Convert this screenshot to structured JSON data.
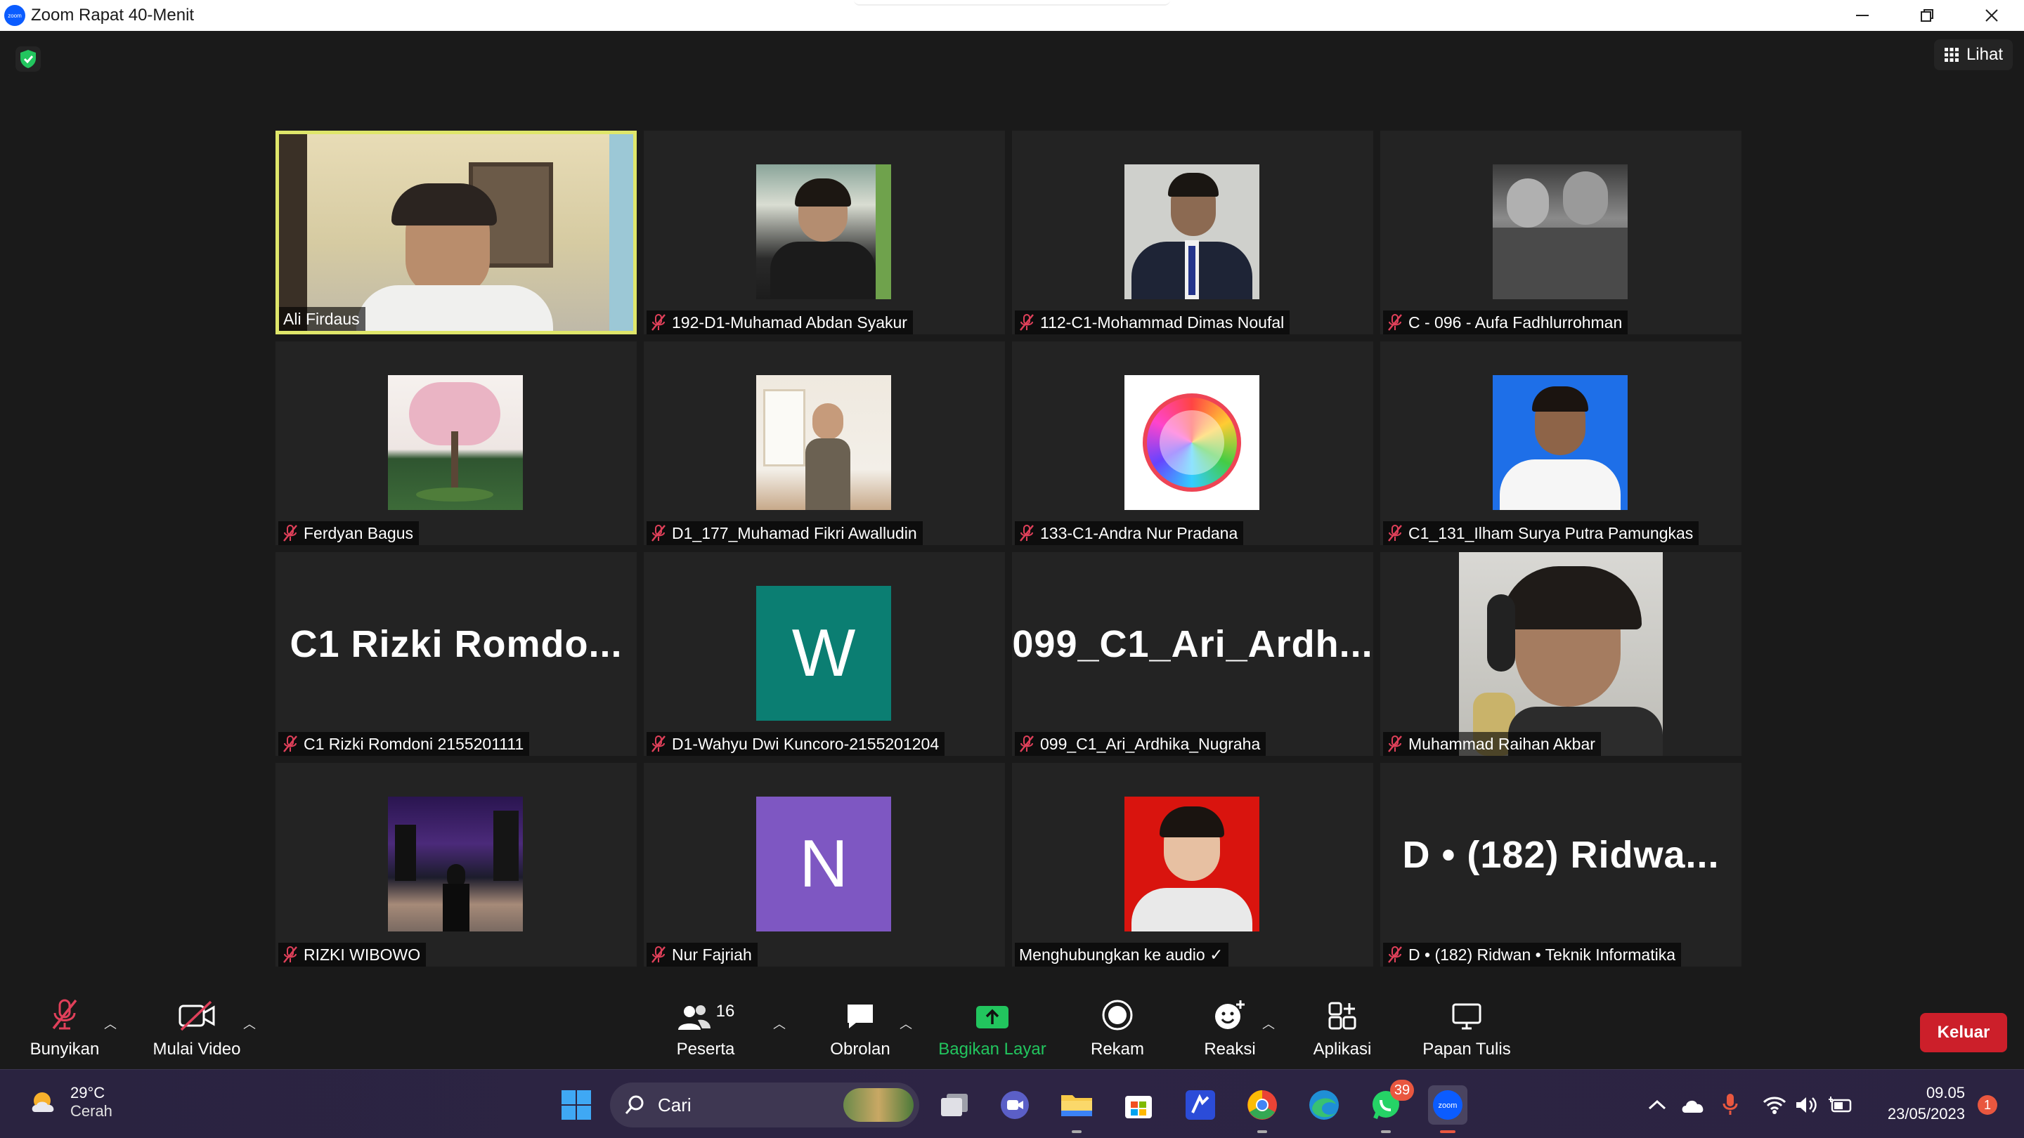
{
  "window": {
    "title": "Zoom Rapat 40-Menit",
    "logo_text": "zoom"
  },
  "view_button": {
    "label": "Lihat"
  },
  "participants": [
    {
      "name": "Ali Firdaus",
      "muted": false,
      "active": true,
      "avatar": "video-man-room"
    },
    {
      "name": "192-D1-Muhamad Abdan Syakur",
      "muted": true,
      "avatar": "photo-man-black-shirt"
    },
    {
      "name": "112-C1-Mohammad Dimas Noufal",
      "muted": true,
      "avatar": "photo-man-suit"
    },
    {
      "name": "C - 096 - Aufa Fadhlurrohman",
      "muted": true,
      "avatar": "photo-bw-men"
    },
    {
      "name": "Ferdyan Bagus",
      "muted": true,
      "avatar": "photo-pink-tree"
    },
    {
      "name": "D1_177_Muhamad Fikri Awalludin",
      "muted": true,
      "avatar": "photo-man-train"
    },
    {
      "name": "133-C1-Andra Nur Pradana",
      "muted": true,
      "avatar": "photo-rainbow-logo"
    },
    {
      "name": "C1_131_Ilham Surya Putra Pamungkas",
      "muted": true,
      "avatar": "photo-man-blue-bg"
    },
    {
      "name": "C1 Rizki Romdoni 2155201111",
      "muted": true,
      "big_name": "C1 Rizki Romdo..."
    },
    {
      "name": "D1-Wahyu Dwi Kuncoro-2155201204",
      "muted": true,
      "letter": "W",
      "letter_color": "#0b7e72"
    },
    {
      "name": "099_C1_Ari_Ardhika_Nugraha",
      "muted": true,
      "big_name": "099_C1_Ari_Ardh..."
    },
    {
      "name": "Muhammad Raihan Akbar",
      "muted": true,
      "avatar": "video-headphones"
    },
    {
      "name": "RIZKI WIBOWO",
      "muted": true,
      "avatar": "photo-city-night"
    },
    {
      "name": "Nur Fajriah",
      "muted": true,
      "letter": "N",
      "letter_color": "#7e57c2"
    },
    {
      "name": "Menghubungkan ke audio ✓",
      "muted": false,
      "avatar": "photo-man-red-bg"
    },
    {
      "name": "D • (182) Ridwan • Teknik Informatika",
      "muted": true,
      "big_name": "D • (182) Ridwa..."
    }
  ],
  "toolbar": {
    "unmute": "Bunyikan",
    "start_video": "Mulai Video",
    "participants_label": "Peserta",
    "participants_count": "16",
    "chat": "Obrolan",
    "share": "Bagikan Layar",
    "record": "Rekam",
    "reactions": "Reaksi",
    "apps": "Aplikasi",
    "whiteboard": "Papan Tulis",
    "leave": "Keluar"
  },
  "taskbar": {
    "weather_temp": "29°C",
    "weather_cond": "Cerah",
    "search_placeholder": "Cari",
    "whatsapp_badge": "39",
    "time": "09.05",
    "date": "23/05/2023",
    "notification_count": "1"
  },
  "colors": {
    "active_speaker": "#dfe66a",
    "share_green": "#22c55e",
    "leave_red": "#cc1f2a",
    "mute_red": "#e0405a"
  }
}
